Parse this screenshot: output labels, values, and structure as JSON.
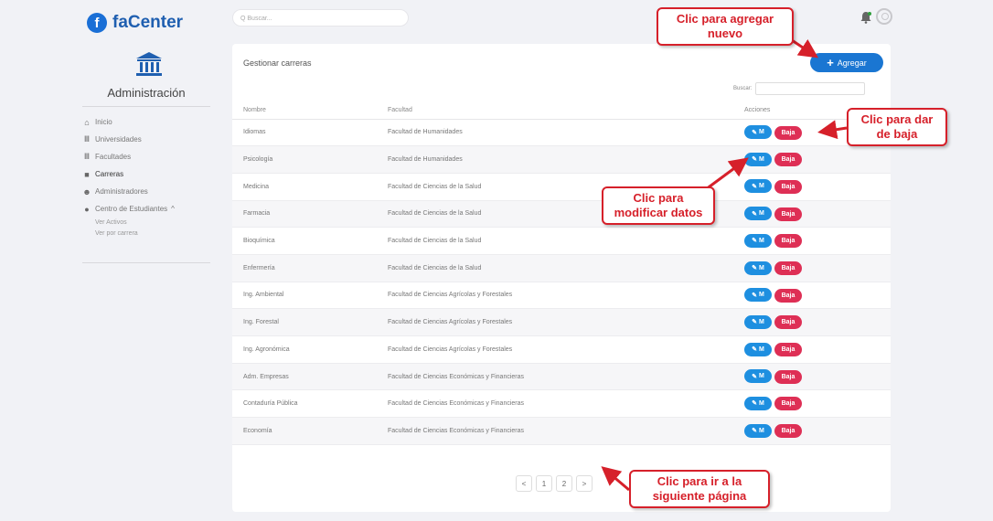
{
  "brand": {
    "name": "faCenter",
    "logo_letter": "f"
  },
  "sidebar": {
    "section_title": "Administración",
    "items": [
      {
        "label": "Inicio",
        "icon": "home-icon"
      },
      {
        "label": "Universidades",
        "icon": "institution-icon"
      },
      {
        "label": "Facultades",
        "icon": "institution-icon"
      },
      {
        "label": "Carreras",
        "icon": "book-icon"
      },
      {
        "label": "Administradores",
        "icon": "users-icon"
      },
      {
        "label": "Centro de Estudiantes",
        "icon": "globe-icon",
        "suffix": "^"
      }
    ],
    "sub_items": [
      "Ver Activos",
      "Ver por carrera"
    ]
  },
  "header": {
    "search_placeholder": "Q Buscar..."
  },
  "card": {
    "title": "Gestionar carreras",
    "add_label": "Agregar",
    "search_label": "Buscar:",
    "columns": [
      "Nombre",
      "Facultad",
      "Acciones"
    ],
    "edit_label": "M",
    "delete_label": "Baja",
    "rows": [
      {
        "nombre": "Idiomas",
        "facultad": "Facultad de Humanidades"
      },
      {
        "nombre": "Psicología",
        "facultad": "Facultad de Humanidades"
      },
      {
        "nombre": "Medicina",
        "facultad": "Facultad de Ciencias de la Salud"
      },
      {
        "nombre": "Farmacia",
        "facultad": "Facultad de Ciencias de la Salud"
      },
      {
        "nombre": "Bioquímica",
        "facultad": "Facultad de Ciencias de la Salud"
      },
      {
        "nombre": "Enfermería",
        "facultad": "Facultad de Ciencias de la Salud"
      },
      {
        "nombre": "Ing. Ambiental",
        "facultad": "Facultad de Ciencias Agrícolas y Forestales"
      },
      {
        "nombre": "Ing. Forestal",
        "facultad": "Facultad de Ciencias Agrícolas y Forestales"
      },
      {
        "nombre": "Ing. Agronómica",
        "facultad": "Facultad de Ciencias Agrícolas y Forestales"
      },
      {
        "nombre": "Adm. Empresas",
        "facultad": "Facultad de Ciencias Económicas y Financieras"
      },
      {
        "nombre": "Contaduría Pública",
        "facultad": "Facultad de Ciencias Económicas y Financieras"
      },
      {
        "nombre": "Economía",
        "facultad": "Facultad de Ciencias Económicas y Financieras"
      }
    ],
    "pagination": {
      "prev": "<",
      "pages": [
        "1",
        "2"
      ],
      "next": ">"
    }
  },
  "annotations": {
    "add": "Clic para agregar nuevo",
    "delete": "Clic para dar de baja",
    "edit": "Clic para modificar datos",
    "next": "Clic para ir a la siguiente página"
  },
  "colors": {
    "accent": "#1a76d2",
    "danger": "#de2f55",
    "callout": "#d6202a"
  }
}
